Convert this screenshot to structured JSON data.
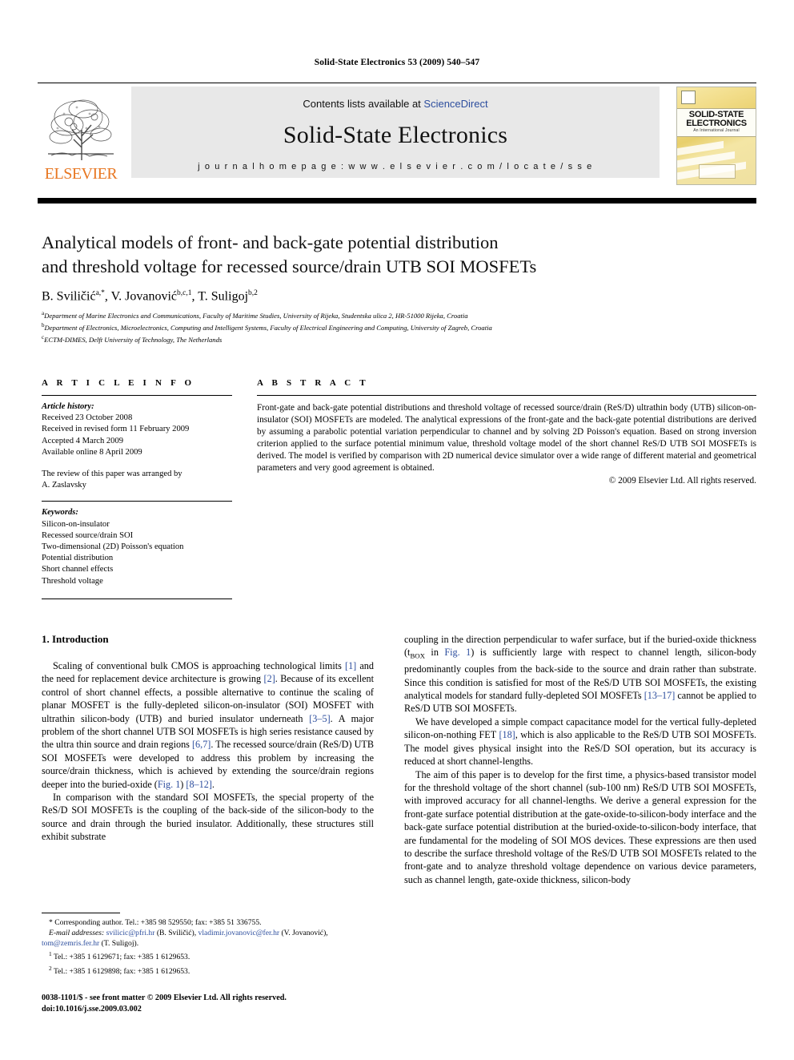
{
  "running_head": "Solid-State Electronics 53 (2009) 540–547",
  "masthead": {
    "contents_prefix": "Contents lists available at ",
    "sciencedirect": "ScienceDirect",
    "journal_title": "Solid-State Electronics",
    "homepage": "j o u r n a l   h o m e p a g e :   w w w . e l s e v i e r . c o m / l o c a t e / s s e",
    "publisher_name": "ELSEVIER",
    "cover": {
      "line1": "SOLID-STATE",
      "line2": "ELECTRONICS",
      "line3": "An International Journal"
    },
    "accent_orange": "#E87722",
    "link_blue": "#2D4E9E",
    "banner_bg": "#E8E8E8"
  },
  "article": {
    "title_line1": "Analytical models of front- and back-gate potential distribution",
    "title_line2": "and threshold voltage for recessed source/drain UTB SOI MOSFETs",
    "authors": [
      {
        "name": "B. Sviličić",
        "marks": "a,*"
      },
      {
        "name": "V. Jovanović",
        "marks": "b,c,1"
      },
      {
        "name": "T. Suligoj",
        "marks": "b,2"
      }
    ],
    "affiliations": [
      {
        "mark": "a",
        "text": "Department of Marine Electronics and Communications, Faculty of Maritime Studies, University of Rijeka, Studentska ulica 2, HR-51000 Rijeka, Croatia"
      },
      {
        "mark": "b",
        "text": "Department of Electronics, Microelectronics, Computing and Intelligent Systems, Faculty of Electrical Engineering and Computing, University of Zagreb, Croatia"
      },
      {
        "mark": "c",
        "text": "ECTM-DIMES, Delft University of Technology, The Netherlands"
      }
    ]
  },
  "article_info": {
    "heading": "A R T I C L E   I N F O",
    "history_label": "Article history:",
    "history": [
      "Received 23 October 2008",
      "Received in revised form 11 February 2009",
      "Accepted 4 March 2009",
      "Available online 8 April 2009"
    ],
    "review_note_line1": "The review of this paper was arranged by",
    "review_note_line2": "A. Zaslavsky",
    "keywords_label": "Keywords:",
    "keywords": [
      "Silicon-on-insulator",
      "Recessed source/drain SOI",
      "Two-dimensional (2D) Poisson's equation",
      "Potential distribution",
      "Short channel effects",
      "Threshold voltage"
    ]
  },
  "abstract": {
    "heading": "A B S T R A C T",
    "text": "Front-gate and back-gate potential distributions and threshold voltage of recessed source/drain (ReS/D) ultrathin body (UTB) silicon-on-insulator (SOI) MOSFETs are modeled. The analytical expressions of the front-gate and the back-gate potential distributions are derived by assuming a parabolic potential variation perpendicular to channel and by solving 2D Poisson's equation. Based on strong inversion criterion applied to the surface potential minimum value, threshold voltage model of the short channel ReS/D UTB SOI MOSFETs is derived. The model is verified by comparison with 2D numerical device simulator over a wide range of different material and geometrical parameters and very good agreement is obtained.",
    "copyright": "© 2009 Elsevier Ltd. All rights reserved."
  },
  "introduction": {
    "heading": "1. Introduction",
    "left_paragraphs": [
      "Scaling of conventional bulk CMOS is approaching technological limits [1] and the need for replacement device architecture is growing [2]. Because of its excellent control of short channel effects, a possible alternative to continue the scaling of planar MOSFET is the fully-depleted silicon-on-insulator (SOI) MOSFET with ultrathin silicon-body (UTB) and buried insulator underneath [3–5]. A major problem of the short channel UTB SOI MOSFETs is high series resistance caused by the ultra thin source and drain regions [6,7]. The recessed source/drain (ReS/D) UTB SOI MOSFETs were developed to address this problem by increasing the source/drain thickness, which is achieved by extending the source/drain regions deeper into the buried-oxide (Fig. 1) [8–12].",
      "In comparison with the standard SOI MOSFETs, the special property of the ReS/D SOI MOSFETs is the coupling of the back-side of the silicon-body to the source and drain through the buried insulator. Additionally, these structures still exhibit substrate"
    ],
    "right_paragraphs": [
      "coupling in the direction perpendicular to wafer surface, but if the buried-oxide thickness (tBOX in Fig. 1) is sufficiently large with respect to channel length, silicon-body predominantly couples from the back-side to the source and drain rather than substrate. Since this condition is satisfied for most of the ReS/D UTB SOI MOSFETs, the existing analytical models for standard fully-depleted SOI MOSFETs [13–17] cannot be applied to ReS/D UTB SOI MOSFETs.",
      "We have developed a simple compact capacitance model for the vertical fully-depleted silicon-on-nothing FET [18], which is also applicable to the ReS/D UTB SOI MOSFETs. The model gives physical insight into the ReS/D SOI operation, but its accuracy is reduced at short channel-lengths.",
      "The aim of this paper is to develop for the first time, a physics-based transistor model for the threshold voltage of the short channel (sub-100 nm) ReS/D UTB SOI MOSFETs, with improved accuracy for all channel-lengths. We derive a general expression for the front-gate surface potential distribution at the gate-oxide-to-silicon-body interface and the back-gate surface potential distribution at the buried-oxide-to-silicon-body interface, that are fundamental for the modeling of SOI MOS devices. These expressions are then used to describe the surface threshold voltage of the ReS/D UTB SOI MOSFETs related to the front-gate and to analyze threshold voltage dependence on various device parameters, such as channel length, gate-oxide thickness, silicon-body"
    ]
  },
  "footnotes": {
    "corresponding": "* Corresponding author. Tel.: +385 98 529550; fax: +385 51 336755.",
    "email_label": "E-mail addresses:",
    "email1": "svilicic@pfri.hr",
    "email1_owner": "(B. Sviličić),",
    "email2": "vladimir.jovanovic@fer.hr",
    "email2_owner": "(V. Jovanović),",
    "email3": "tom@zemris.fer.hr",
    "email3_owner": "(T. Suligoj).",
    "note1_mark": "1",
    "note1": "Tel.: +385 1 6129671; fax: +385 1 6129653.",
    "note2_mark": "2",
    "note2": "Tel.: +385 1 6129898; fax: +385 1 6129653."
  },
  "imprint": {
    "line1": "0038-1101/$ - see front matter © 2009 Elsevier Ltd. All rights reserved.",
    "line2": "doi:10.1016/j.sse.2009.03.002"
  }
}
